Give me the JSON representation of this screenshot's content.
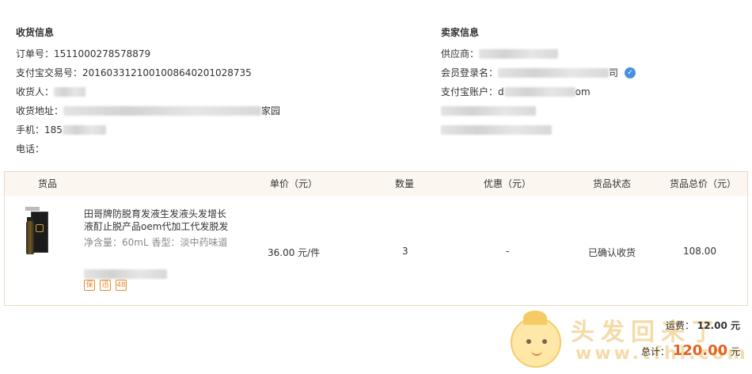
{
  "receiver": {
    "title": "收货信息",
    "order_no_label": "订单号：",
    "order_no": "1511000278578879",
    "alipay_trade_label": "支付宝交易号：",
    "alipay_trade_no": "2016033121001008640201028735",
    "receiver_label": "收货人：",
    "address_label": "收货地址：",
    "address_tail": "家园",
    "phone_label": "手机：",
    "phone_prefix": "185",
    "tel_label": "电话："
  },
  "seller": {
    "title": "卖家信息",
    "supplier_label": "供应商：",
    "member_label": "会员登录名：",
    "member_tail": "司",
    "alipay_label": "支付宝账户：",
    "alipay_prefix": "d",
    "alipay_suffix": "om"
  },
  "table": {
    "headers": {
      "goods": "货品",
      "unit_price": "单价（元）",
      "quantity": "数量",
      "discount": "优惠（元）",
      "status": "货品状态",
      "total": "货品总价（元）"
    },
    "item": {
      "title": "田哥牌防脱育发液生发液头发增长液酊止脱产品oem代加工代发脱发",
      "spec": "净含量：60mL 香型：淡中药味道",
      "unit_price": "36.00 元/件",
      "quantity": "3",
      "discount": "-",
      "status": "已确认收货",
      "total": "108.00",
      "badges": [
        "保",
        "迅",
        "48"
      ]
    }
  },
  "summary": {
    "shipping_label": "运费：",
    "shipping": "12.00 元",
    "total_label": "总计：",
    "total": "120.00",
    "total_unit": "元"
  },
  "watermark": {
    "line1": "头发回来了",
    "line2": "www.tfhl.com"
  }
}
